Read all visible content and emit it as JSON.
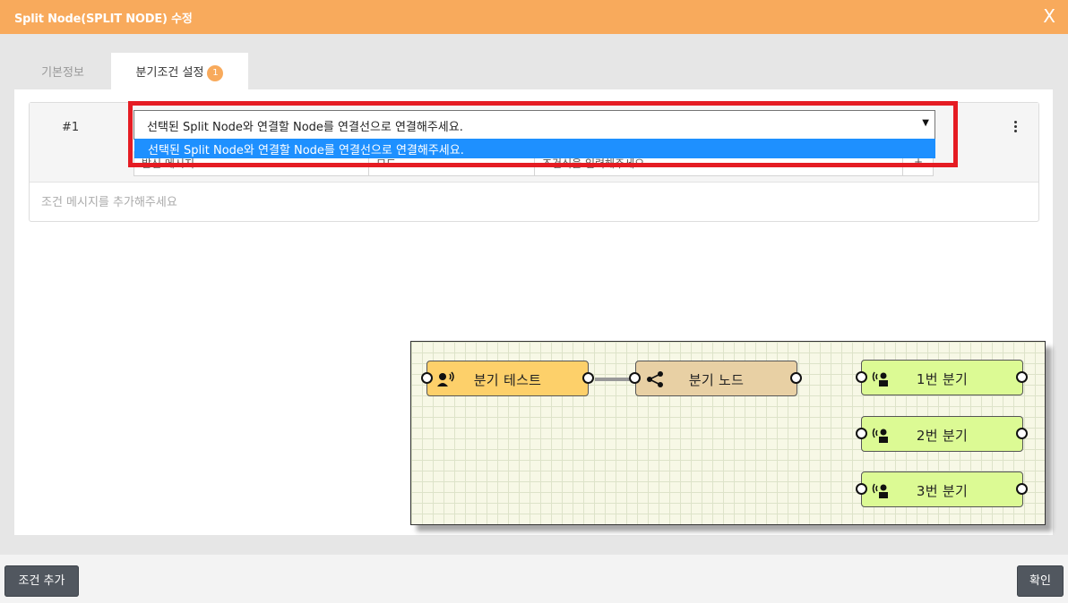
{
  "titlebar": {
    "title": "Split Node(SPLIT NODE) 수정",
    "close_glyph": "X"
  },
  "tabs": [
    {
      "label": "기본정보"
    },
    {
      "label": "분기조건 설정",
      "badge": "1"
    }
  ],
  "condition": {
    "number": "#1",
    "select": {
      "value": "선택된 Split Node와 연결할 Node를 연결선으로 연결해주세요.",
      "options": [
        "선택된 Split Node와 연결할 Node를 연결선으로 연결해주세요."
      ]
    },
    "hidden_cells": [
      "발신 메시지",
      "모드",
      "조건식을 입력해주세요"
    ],
    "empty_message": "조건 메시지를 추가해주세요"
  },
  "diagram": {
    "nodes": [
      {
        "label": "분기 테스트",
        "icon": "contact-speaker-icon",
        "color": "#fdd06a"
      },
      {
        "label": "분기 노드",
        "icon": "share-split-icon",
        "color": "#e8d0a4"
      },
      {
        "label": "1번 분기",
        "icon": "broadcast-person-icon",
        "color": "#dcfa94"
      },
      {
        "label": "2번 분기",
        "icon": "broadcast-person-icon",
        "color": "#dcfa94"
      },
      {
        "label": "3번 분기",
        "icon": "broadcast-person-icon",
        "color": "#dcfa94"
      }
    ]
  },
  "footer": {
    "add_label": "조건 추가",
    "ok_label": "확인"
  },
  "colors": {
    "accent": "#f8aa5c",
    "highlight": "#e51c23",
    "option_selected": "#1e90ff",
    "button": "#51575f"
  }
}
